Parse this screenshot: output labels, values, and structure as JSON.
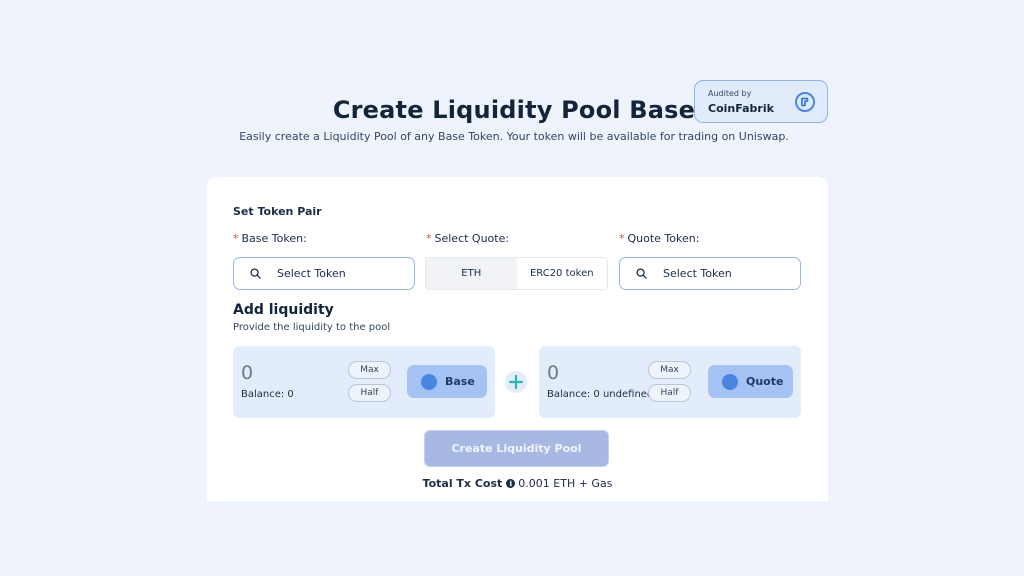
{
  "audit": {
    "caption": "Audited by",
    "brand": "CoinFabrik"
  },
  "header": {
    "title": "Create Liquidity Pool Base",
    "subtitle": "Easily create a Liquidity Pool of any Base Token. Your token will be available for trading on Uniswap."
  },
  "token_pair": {
    "section_label": "Set Token Pair",
    "base_label": "Base Token:",
    "quote_select_label": "Select Quote:",
    "quote_label": "Quote Token:",
    "base_placeholder": "Select Token",
    "quote_placeholder": "Select Token",
    "quote_options": [
      "ETH",
      "ERC20 token"
    ]
  },
  "liquidity": {
    "title": "Add liquidity",
    "subtitle": "Provide the liquidity to the pool",
    "base": {
      "amount": "0",
      "balance": "Balance: 0",
      "max_label": "Max",
      "half_label": "Half",
      "token_label": "Base"
    },
    "quote": {
      "amount": "0",
      "balance": "Balance: 0 undefined",
      "max_label": "Max",
      "half_label": "Half",
      "token_label": "Quote"
    }
  },
  "actions": {
    "create_label": "Create Liquidity Pool",
    "tx_cost_label": "Total Tx Cost",
    "tx_cost_value": "0.001 ETH + Gas"
  },
  "icons": {
    "search": "search-icon",
    "plus": "plus-icon",
    "info": "info-icon",
    "audit_logo": "coinfabrik-logo-icon"
  },
  "colors": {
    "background": "#eef3fc",
    "accent": "#4a86e0",
    "required": "#e54848",
    "plus": "#2bb5b0"
  }
}
